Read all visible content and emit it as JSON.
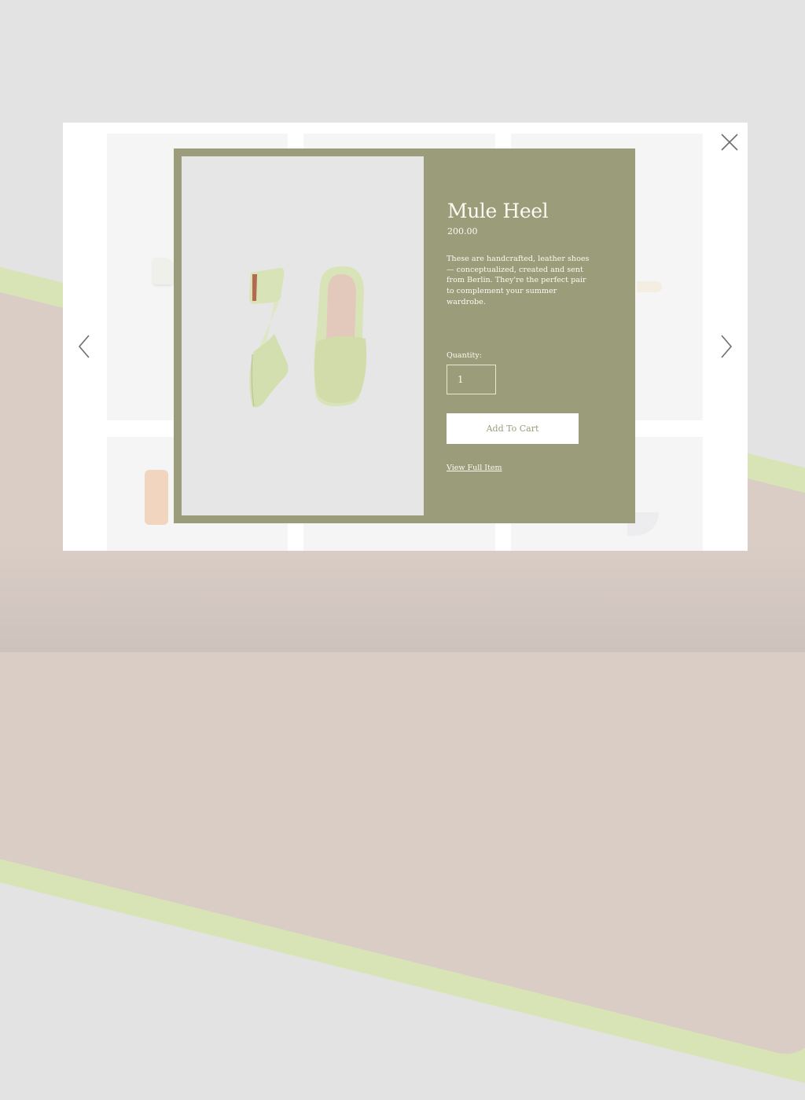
{
  "product": {
    "title": "Mule Heel",
    "price": "200.00",
    "description": "These are handcrafted, leather shoes — conceptualized, created and sent from Berlin. They're the perfect pair to complement your summer wardrobe.",
    "quantity_label": "Quantity:",
    "quantity_value": "1",
    "add_to_cart_label": "Add To Cart",
    "view_full_item_label": "View Full Item"
  },
  "icons": {
    "close": "close-icon",
    "previous": "chevron-left-icon",
    "next": "chevron-right-icon"
  },
  "colors": {
    "modal_background": "#9b9c7a",
    "product_image_background": "#e6e6e7",
    "shoe_color": "#d9e3b8",
    "panel_background": "#ffffff",
    "page_background": "#e3e3e3"
  }
}
